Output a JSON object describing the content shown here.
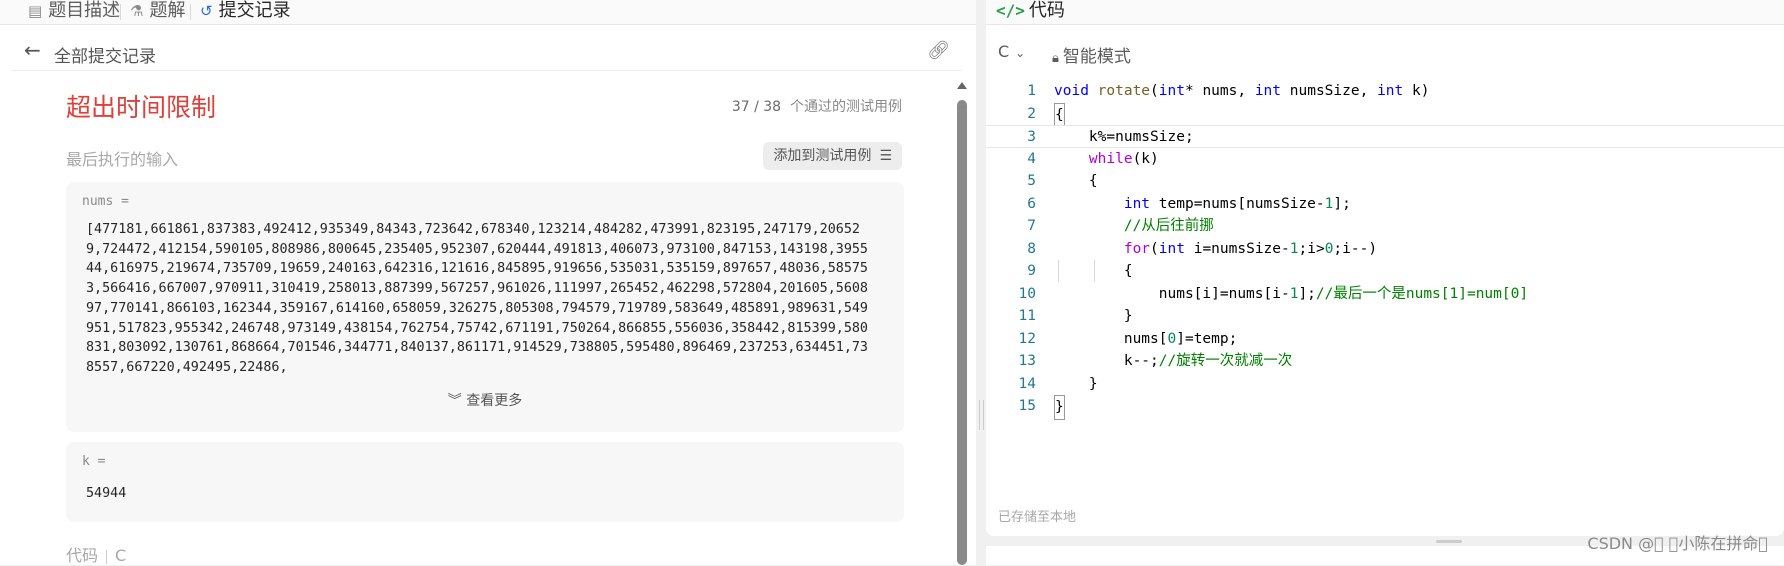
{
  "tabs": [
    {
      "label": "题目描述",
      "icon": "document-icon"
    },
    {
      "label": "题解",
      "icon": "flask-icon"
    },
    {
      "label": "提交记录",
      "icon": "history-icon"
    }
  ],
  "submission": {
    "back_label": "全部提交记录",
    "status": "超出时间限制",
    "passed_count": "37 / 38",
    "passed_suffix": "个通过的测试用例",
    "last_input_label": "最后执行的输入",
    "add_testcase_label": "添加到测试用例",
    "nums_label": "nums =",
    "nums_value": "[477181,661861,837383,492412,935349,84343,723642,678340,123214,484282,473991,823195,247179,206529,724472,412154,590105,808986,800645,235405,952307,620444,491813,406073,973100,847153,143198,395544,616975,219674,735709,19659,240163,642316,121616,845895,919656,535031,535159,897657,48036,585753,566416,667007,970911,310419,258013,887399,567257,961026,111997,265452,462298,572804,201605,560897,770141,866103,162344,359167,614160,658059,326275,805308,794579,719789,583649,485891,989631,549951,517823,955342,246748,973149,438154,762754,75742,671191,750264,866855,556036,358442,815399,580831,803092,130761,868664,701546,344771,840137,861171,914529,738805,595480,896469,237253,634451,738557,667220,492495,22486,",
    "show_more_label": "查看更多",
    "k_label": "k =",
    "k_value": "54944",
    "code_label": "代码",
    "code_lang": "C"
  },
  "editor": {
    "title": "代码",
    "language": "C",
    "mode_label": "智能模式",
    "saved_label": "已存储至本地",
    "lines": [
      {
        "n": "1",
        "text": "void rotate(int* nums, int numsSize, int k)"
      },
      {
        "n": "2",
        "text": "{"
      },
      {
        "n": "3",
        "text": "k%=numsSize;"
      },
      {
        "n": "4",
        "text": "while(k)"
      },
      {
        "n": "5",
        "text": "{"
      },
      {
        "n": "6",
        "text": "int temp=nums[numsSize-1];"
      },
      {
        "n": "7",
        "text": "//从后往前挪"
      },
      {
        "n": "8",
        "text": "for(int i=numsSize-1;i>0;i--)"
      },
      {
        "n": "9",
        "text": "{"
      },
      {
        "n": "10",
        "text": "nums[i]=nums[i-1];//最后一个是nums[1]=num[0]"
      },
      {
        "n": "11",
        "text": "}"
      },
      {
        "n": "12",
        "text": "nums[0]=temp;"
      },
      {
        "n": "13",
        "text": "k--;//旋转一次就减一次"
      },
      {
        "n": "14",
        "text": "}"
      },
      {
        "n": "15",
        "text": "}"
      }
    ]
  },
  "watermark": "CSDN @\u0000 \u0000小陈在拼命\u0000",
  "colors": {
    "error": "#e0403a",
    "accent": "#2b6be6",
    "code_green": "#2a9d4a"
  }
}
